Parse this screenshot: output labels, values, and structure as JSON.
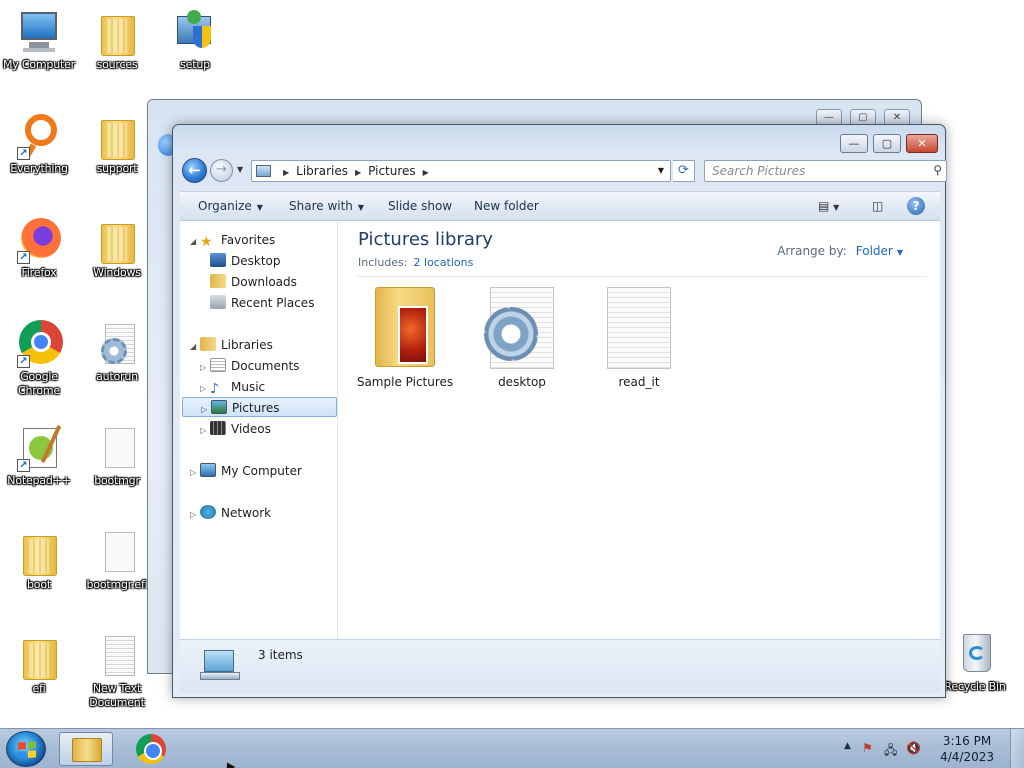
{
  "desktop": {
    "icons": [
      {
        "label": "My Computer"
      },
      {
        "label": "sources"
      },
      {
        "label": "setup"
      },
      {
        "label": "Everything"
      },
      {
        "label": "support"
      },
      {
        "label": "Firefox"
      },
      {
        "label": "Windows"
      },
      {
        "label": "Google Chrome"
      },
      {
        "label": "autorun"
      },
      {
        "label": "Notepad++"
      },
      {
        "label": "bootmgr"
      },
      {
        "label": "boot"
      },
      {
        "label": "bootmgr.efi"
      },
      {
        "label": "efi"
      },
      {
        "label": "New Text Document"
      },
      {
        "label": "Recycle Bin"
      }
    ]
  },
  "window": {
    "controls": {
      "minimize": "—",
      "maximize": "▢",
      "close": "✕"
    },
    "breadcrumb": [
      "Libraries",
      "Pictures"
    ],
    "search_placeholder": "Search Pictures",
    "toolbar": {
      "organize": "Organize",
      "share_with": "Share with",
      "slide_show": "Slide show",
      "new_folder": "New folder"
    },
    "nav": {
      "favorites": "Favorites",
      "desktop": "Desktop",
      "downloads": "Downloads",
      "recent_places": "Recent Places",
      "libraries": "Libraries",
      "documents": "Documents",
      "music": "Music",
      "pictures": "Pictures",
      "videos": "Videos",
      "my_computer": "My Computer",
      "network": "Network"
    },
    "content": {
      "title": "Pictures library",
      "includes_label": "Includes:",
      "includes_link": "2 locations",
      "arrange_by_label": "Arrange by:",
      "arrange_by_value": "Folder",
      "items": [
        {
          "name": "Sample Pictures",
          "type": "folder"
        },
        {
          "name": "desktop",
          "type": "settings-file"
        },
        {
          "name": "read_it",
          "type": "text-file"
        }
      ]
    },
    "status": {
      "item_count": "3 items"
    }
  },
  "taskbar": {
    "apps": [
      "Windows Explorer",
      "Google Chrome"
    ],
    "time": "3:16 PM",
    "date": "4/4/2023"
  }
}
